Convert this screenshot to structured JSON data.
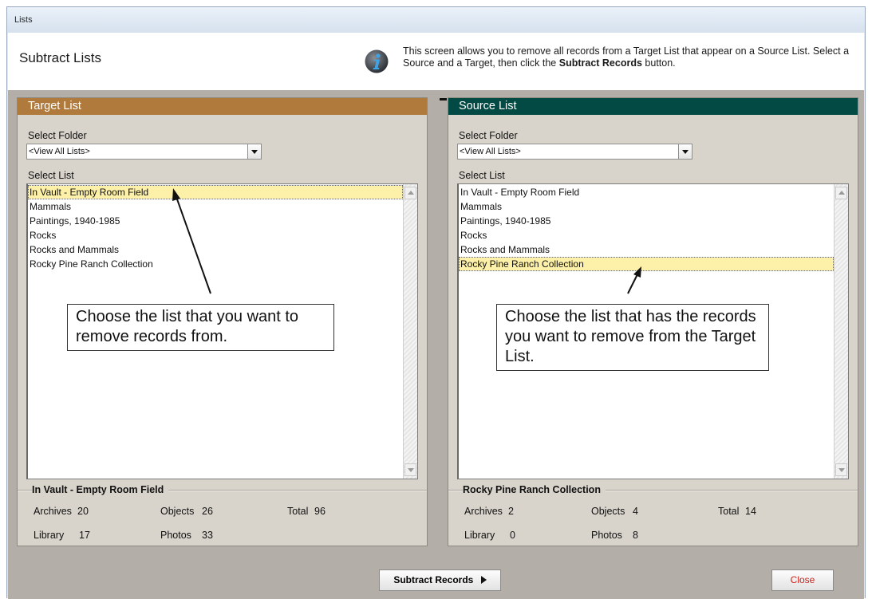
{
  "window": {
    "title": "Lists"
  },
  "header": {
    "title": "Subtract Lists",
    "info_text_1": "This screen allows you to remove all records from a Target List that appear on a Source List.  Select a Source and a Target, then click the ",
    "info_text_bold": "Subtract Records",
    "info_text_2": " button.",
    "icon": "info-icon"
  },
  "operator": "-",
  "target": {
    "heading": "Target List",
    "heading_color": "#b07a3c",
    "folder_label": "Select Folder",
    "folder_value": "<View All Lists>",
    "list_label": "Select List",
    "items": [
      "In Vault - Empty Room Field",
      "Mammals",
      "Paintings, 1940-1985",
      "Rocks",
      "Rocks and Mammals",
      "Rocky Pine Ranch Collection"
    ],
    "selected_index": 0,
    "callout": "Choose the list that you want to remove records from.",
    "summary": {
      "title": "In Vault - Empty Room Field",
      "archives_label": "Archives",
      "archives": "20",
      "library_label": "Library",
      "library": "17",
      "objects_label": "Objects",
      "objects": "26",
      "photos_label": "Photos",
      "photos": "33",
      "total_label": "Total",
      "total": "96"
    }
  },
  "source": {
    "heading": "Source List",
    "heading_color": "#024a43",
    "folder_label": "Select Folder",
    "folder_value": "<View All Lists>",
    "list_label": "Select List",
    "items": [
      "In Vault - Empty Room Field",
      "Mammals",
      "Paintings, 1940-1985",
      "Rocks",
      "Rocks and Mammals",
      "Rocky Pine Ranch Collection"
    ],
    "selected_index": 5,
    "callout": "Choose the list that has the records you want to remove from the Target List.",
    "summary": {
      "title": "Rocky Pine Ranch Collection",
      "archives_label": "Archives",
      "archives": "2",
      "library_label": "Library",
      "library": "0",
      "objects_label": "Objects",
      "objects": "4",
      "photos_label": "Photos",
      "photos": "8",
      "total_label": "Total",
      "total": "14"
    }
  },
  "footer": {
    "subtract_label": "Subtract Records",
    "close_label": "Close",
    "close_color": "#d0201a"
  }
}
